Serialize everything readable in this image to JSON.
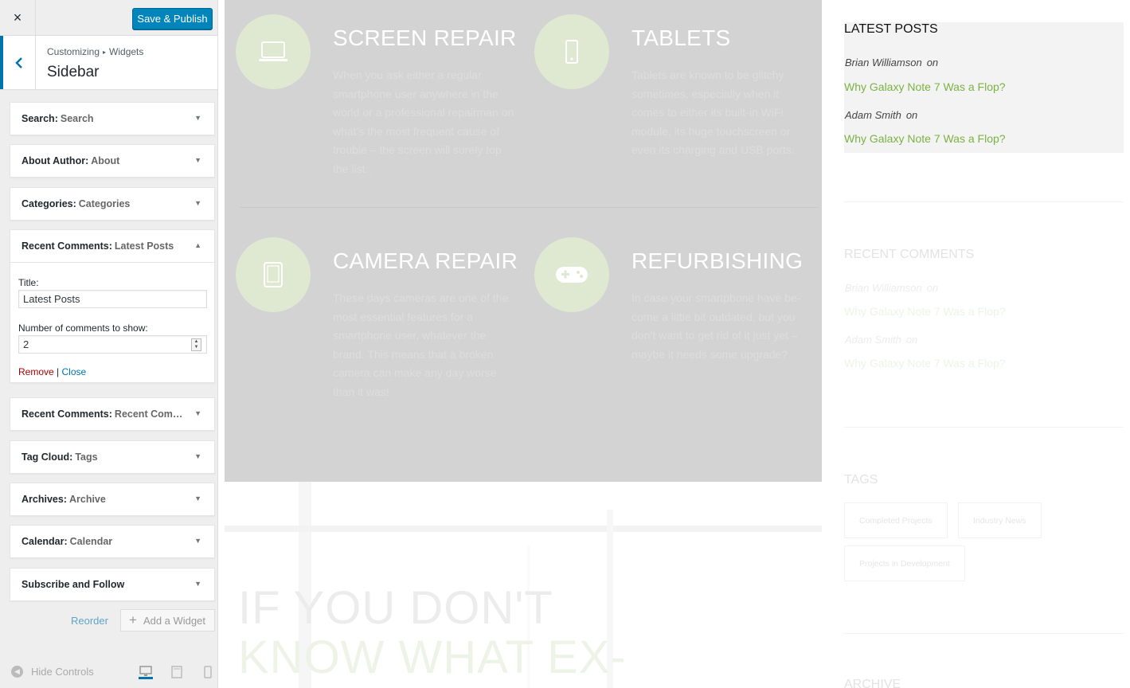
{
  "customizer": {
    "close_label": "×",
    "publish_label": "Save & Publish",
    "breadcrumb_root": "Customizing",
    "breadcrumb_sep": "▸",
    "breadcrumb_leaf": "Widgets",
    "section_title": "Sidebar",
    "widgets": [
      {
        "name": "Search:",
        "title": "Search",
        "expanded": false
      },
      {
        "name": "About Author:",
        "title": "About",
        "expanded": false
      },
      {
        "name": "Categories:",
        "title": "Categories",
        "expanded": false
      },
      {
        "name": "Recent Comments:",
        "title": "Latest Posts",
        "expanded": true
      },
      {
        "name": "Recent Comments:",
        "title": "Recent Com…",
        "expanded": false
      },
      {
        "name": "Tag Cloud:",
        "title": "Tags",
        "expanded": false
      },
      {
        "name": "Archives:",
        "title": "Archive",
        "expanded": false
      },
      {
        "name": "Calendar:",
        "title": "Calendar",
        "expanded": false
      },
      {
        "name": "Subscribe and Follow",
        "title": "",
        "expanded": false
      }
    ],
    "form": {
      "title_label": "Title:",
      "title_value": "Latest Posts",
      "count_label": "Number of comments to show:",
      "count_value": "2",
      "remove_label": "Remove",
      "divider": "|",
      "close_label": "Close"
    },
    "reorder_label": "Reorder",
    "add_widget_label": "Add a Widget",
    "hide_controls_label": "Hide Controls",
    "accent_color": "#0085ba"
  },
  "preview": {
    "services": [
      {
        "icon": "laptop-icon",
        "title": "SCREEN REPAIR",
        "text": "When you ask either a regular smartphone user anywhere in the world or a professional repairman on what’s the most frequent cause of trouble – the screen will surely top the list.."
      },
      {
        "icon": "smartphone-icon",
        "title": "TABLETS",
        "text": "Tablets are known to be glitchy sometimes, especially when it comes to either its built-in WiFi module, its huge touchscreen or even its charging and USB ports."
      },
      {
        "icon": "tablet-icon",
        "title": "CAMERA REPAIR",
        "text": "These days cameras are one of the most essential features for a smartphone user, whatever the brand. This means that a broken camera can make any day worse than it was!"
      },
      {
        "icon": "gamepad-icon",
        "title": "REFURBISHING",
        "text": "In case your smartphone have be-come a little bit outdated, but you don’t want to get rid of it just yet – maybe it needs some upgrade?"
      }
    ],
    "headline_line1": "IF YOU DON'T",
    "headline_line2": "KNOW WHAT EX-",
    "latest_posts": {
      "title": "LATEST POSTS",
      "on_label": "on",
      "items": [
        {
          "author": "Brian Williamson",
          "link": "Why Galaxy Note 7 Was a Flop?"
        },
        {
          "author": "Adam Smith",
          "link": "Why Galaxy Note 7 Was a Flop?"
        }
      ]
    },
    "recent_comments": {
      "title": "RECENT COMMENTS",
      "items": [
        {
          "author": "Brian Williamson",
          "link": "Why Galaxy Note 7 Was a Flop?"
        },
        {
          "author": "Adam Smith",
          "link": "Why Galaxy Note 7 Was a Flop?"
        }
      ]
    },
    "tags": {
      "title": "TAGS",
      "items": [
        "Completed Projects",
        "Industry News",
        "Projects in Development"
      ]
    },
    "archive_title": "ARCHIVE",
    "link_color": "#7ab342"
  }
}
